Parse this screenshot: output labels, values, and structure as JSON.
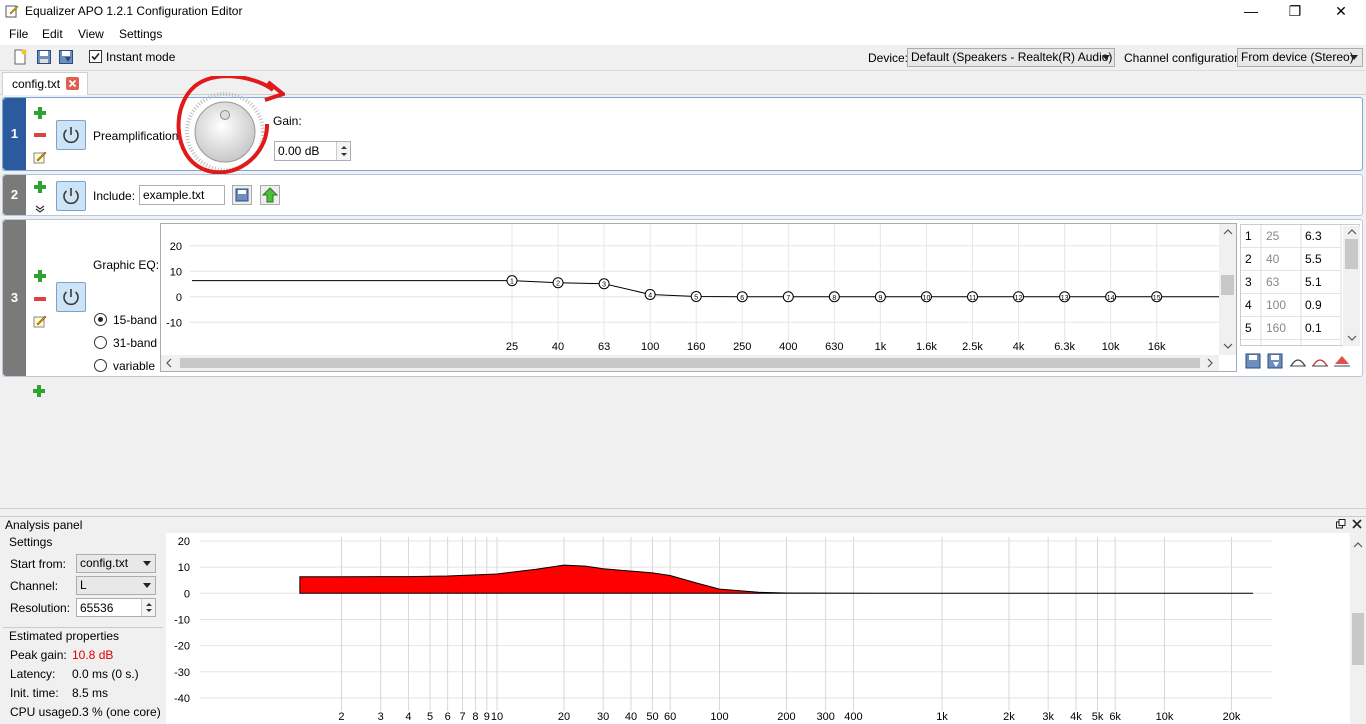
{
  "window": {
    "title": "Equalizer APO 1.2.1 Configuration Editor",
    "minimize": "—",
    "maximize": "❐",
    "close": "✕"
  },
  "menu": {
    "file": "File",
    "edit": "Edit",
    "view": "View",
    "settings": "Settings"
  },
  "toolbar": {
    "instant_mode_label": "Instant mode",
    "instant_mode_checked": true,
    "device_label": "Device:",
    "device_value": "Default (Speakers - Realtek(R) Audio)",
    "channel_config_label": "Channel configuration:",
    "channel_config_value": "From device (Stereo)"
  },
  "tab": {
    "label": "config.txt"
  },
  "filters": {
    "f1": {
      "index": "1",
      "label": "Preamplification:",
      "gain_label": "Gain:",
      "gain_value": "0.00 dB"
    },
    "f2": {
      "index": "2",
      "label": "Include:",
      "file_value": "example.txt"
    },
    "f3": {
      "index": "3",
      "label": "Graphic EQ:",
      "modes": [
        "15-band",
        "31-band",
        "variable"
      ],
      "selected_mode": "15-band"
    }
  },
  "geq": {
    "y_ticks": [
      "20",
      "10",
      "0",
      "-10"
    ],
    "ylim": [
      -15,
      25
    ],
    "x_labels": [
      "25",
      "40",
      "63",
      "100",
      "160",
      "250",
      "400",
      "630",
      "1k",
      "1.6k",
      "2.5k",
      "4k",
      "6.3k",
      "10k",
      "16k"
    ],
    "bands": [
      {
        "n": "1",
        "freq": "25",
        "gain": "6.3"
      },
      {
        "n": "2",
        "freq": "40",
        "gain": "5.5"
      },
      {
        "n": "3",
        "freq": "63",
        "gain": "5.1"
      },
      {
        "n": "4",
        "freq": "100",
        "gain": "0.9"
      },
      {
        "n": "5",
        "freq": "160",
        "gain": "0.1"
      },
      {
        "n": "6",
        "freq": "250",
        "gain": "0"
      },
      {
        "n": "7",
        "freq": "400",
        "gain": "0"
      },
      {
        "n": "8",
        "freq": "630",
        "gain": "0"
      },
      {
        "n": "9",
        "freq": "1k",
        "gain": "0"
      },
      {
        "n": "10",
        "freq": "1.6k",
        "gain": "0"
      },
      {
        "n": "11",
        "freq": "2.5k",
        "gain": "0"
      },
      {
        "n": "12",
        "freq": "4k",
        "gain": "0"
      },
      {
        "n": "13",
        "freq": "6.3k",
        "gain": "0"
      },
      {
        "n": "14",
        "freq": "10k",
        "gain": "0"
      },
      {
        "n": "15",
        "freq": "16k",
        "gain": "0"
      }
    ],
    "table_rows_visible": 5
  },
  "analysis": {
    "title": "Analysis panel",
    "settings_title": "Settings",
    "start_from_label": "Start from:",
    "start_from_value": "config.txt",
    "channel_label": "Channel:",
    "channel_value": "L",
    "resolution_label": "Resolution:",
    "resolution_value": "65536",
    "props_title": "Estimated properties",
    "peak_gain_label": "Peak gain:",
    "peak_gain_value": "10.8 dB",
    "latency_label": "Latency:",
    "latency_value": "0.0 ms (0 s.)",
    "init_time_label": "Init. time:",
    "init_time_value": "8.5 ms",
    "cpu_label": "CPU usage:",
    "cpu_value": "0.3 % (one core)"
  },
  "chart_data": {
    "type": "area",
    "y_ticks": [
      "20",
      "10",
      "0",
      "-10",
      "-20",
      "-30",
      "-40"
    ],
    "ylim": [
      -45,
      20
    ],
    "x_tick_labels": [
      "2",
      "3",
      "4",
      "5",
      "6",
      "7",
      "8",
      "9",
      "10",
      "20",
      "30",
      "40",
      "50",
      "60",
      "100",
      "200",
      "300",
      "400",
      "1k",
      "2k",
      "3k",
      "4k",
      "5k",
      "6k",
      "10k",
      "20k"
    ],
    "xlim_hz": [
      1,
      30000
    ],
    "x": [
      1.3,
      2,
      4,
      6,
      10,
      15,
      20,
      25,
      30,
      40,
      50,
      60,
      80,
      100,
      150,
      200,
      500,
      1000,
      5000,
      20000,
      25000
    ],
    "y": [
      6.3,
      6.3,
      6.4,
      6.6,
      7.4,
      9.2,
      10.8,
      10.4,
      9.4,
      8.5,
      7.8,
      6.8,
      3.8,
      1.6,
      0.4,
      0.1,
      0,
      0,
      0,
      0,
      0
    ],
    "fill_color": "#ff0000"
  },
  "colors": {
    "accent": "#0078d7",
    "filter1_index_bg": "#2b5a9e",
    "filter_index_bg": "#7a7a7a",
    "peak_gain_text": "#e00000",
    "annotation_circle": "#e01a1a"
  }
}
